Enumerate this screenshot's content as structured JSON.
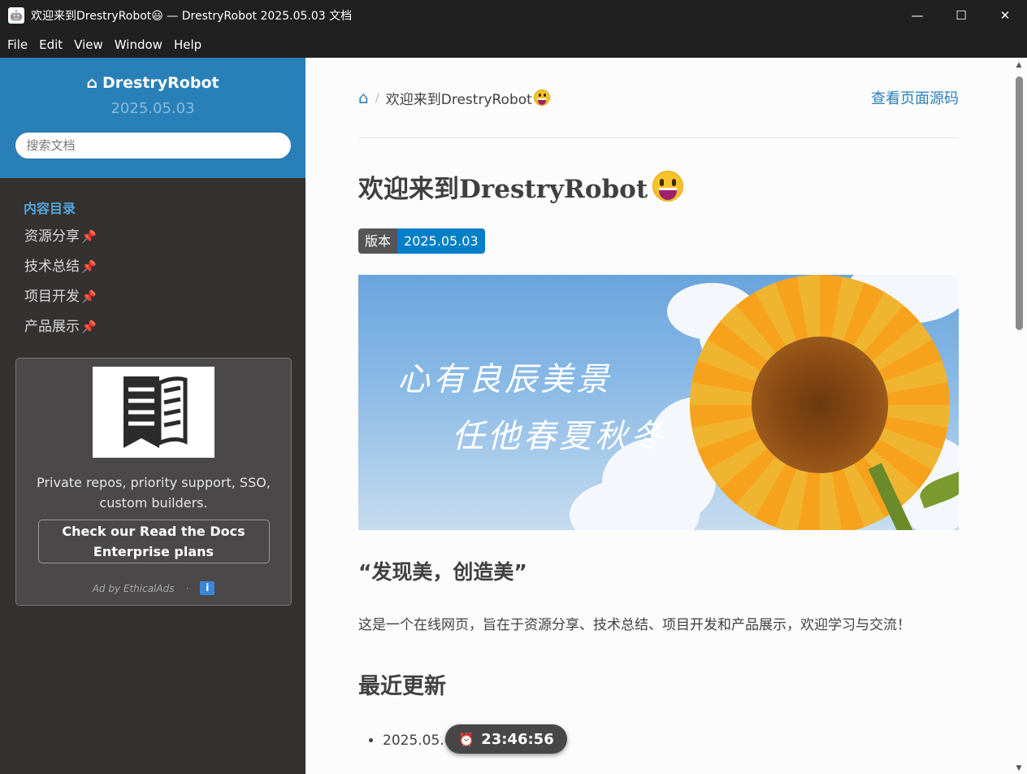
{
  "window": {
    "title": "欢迎来到DrestryRobot😃 — DrestryRobot 2025.05.03 文档",
    "minimize_label": "—",
    "maximize_label": "☐",
    "close_label": "✕"
  },
  "menu": [
    "File",
    "Edit",
    "View",
    "Window",
    "Help"
  ],
  "sidebar": {
    "brand": "DrestryRobot",
    "version": "2025.05.03",
    "search_placeholder": "搜索文档",
    "toc_caption": "内容目录",
    "items": [
      {
        "label": "资源分享"
      },
      {
        "label": "技术总结"
      },
      {
        "label": "项目开发"
      },
      {
        "label": "产品展示"
      }
    ],
    "ad": {
      "text": "Private repos, priority support, SSO, custom builders.",
      "cta": "Check our Read the Docs Enterprise plans",
      "footer": "Ad by EthicalAds",
      "separator": "·",
      "info": "i"
    }
  },
  "content": {
    "breadcrumb_current": "欢迎来到DrestryRobot",
    "breadcrumb_sep": "/",
    "view_source": "查看页面源码",
    "title": "欢迎来到DrestryRobot",
    "badge_label": "版本",
    "badge_value": "2025.05.03",
    "banner_line1": "心有良辰美景",
    "banner_line2": "任他春夏秋冬",
    "quote": "“发现美，创造美”",
    "intro": "这是一个在线网页，旨在于资源分享、技术总结、项目开发和产品展示，欢迎学习与交流！",
    "updates_heading": "最近更新",
    "updates": [
      "2025.05.03"
    ]
  },
  "clock": {
    "time": "23:46:56"
  },
  "colors": {
    "accent": "#2980b9",
    "sidebar_bg": "#343131",
    "badge_label_bg": "#555555",
    "badge_value_bg": "#007ec6",
    "pin": "#e0245e"
  },
  "icons": {
    "home": "home-icon",
    "pin": "pin-icon",
    "clock": "alarm-clock-icon",
    "info": "info-icon"
  }
}
